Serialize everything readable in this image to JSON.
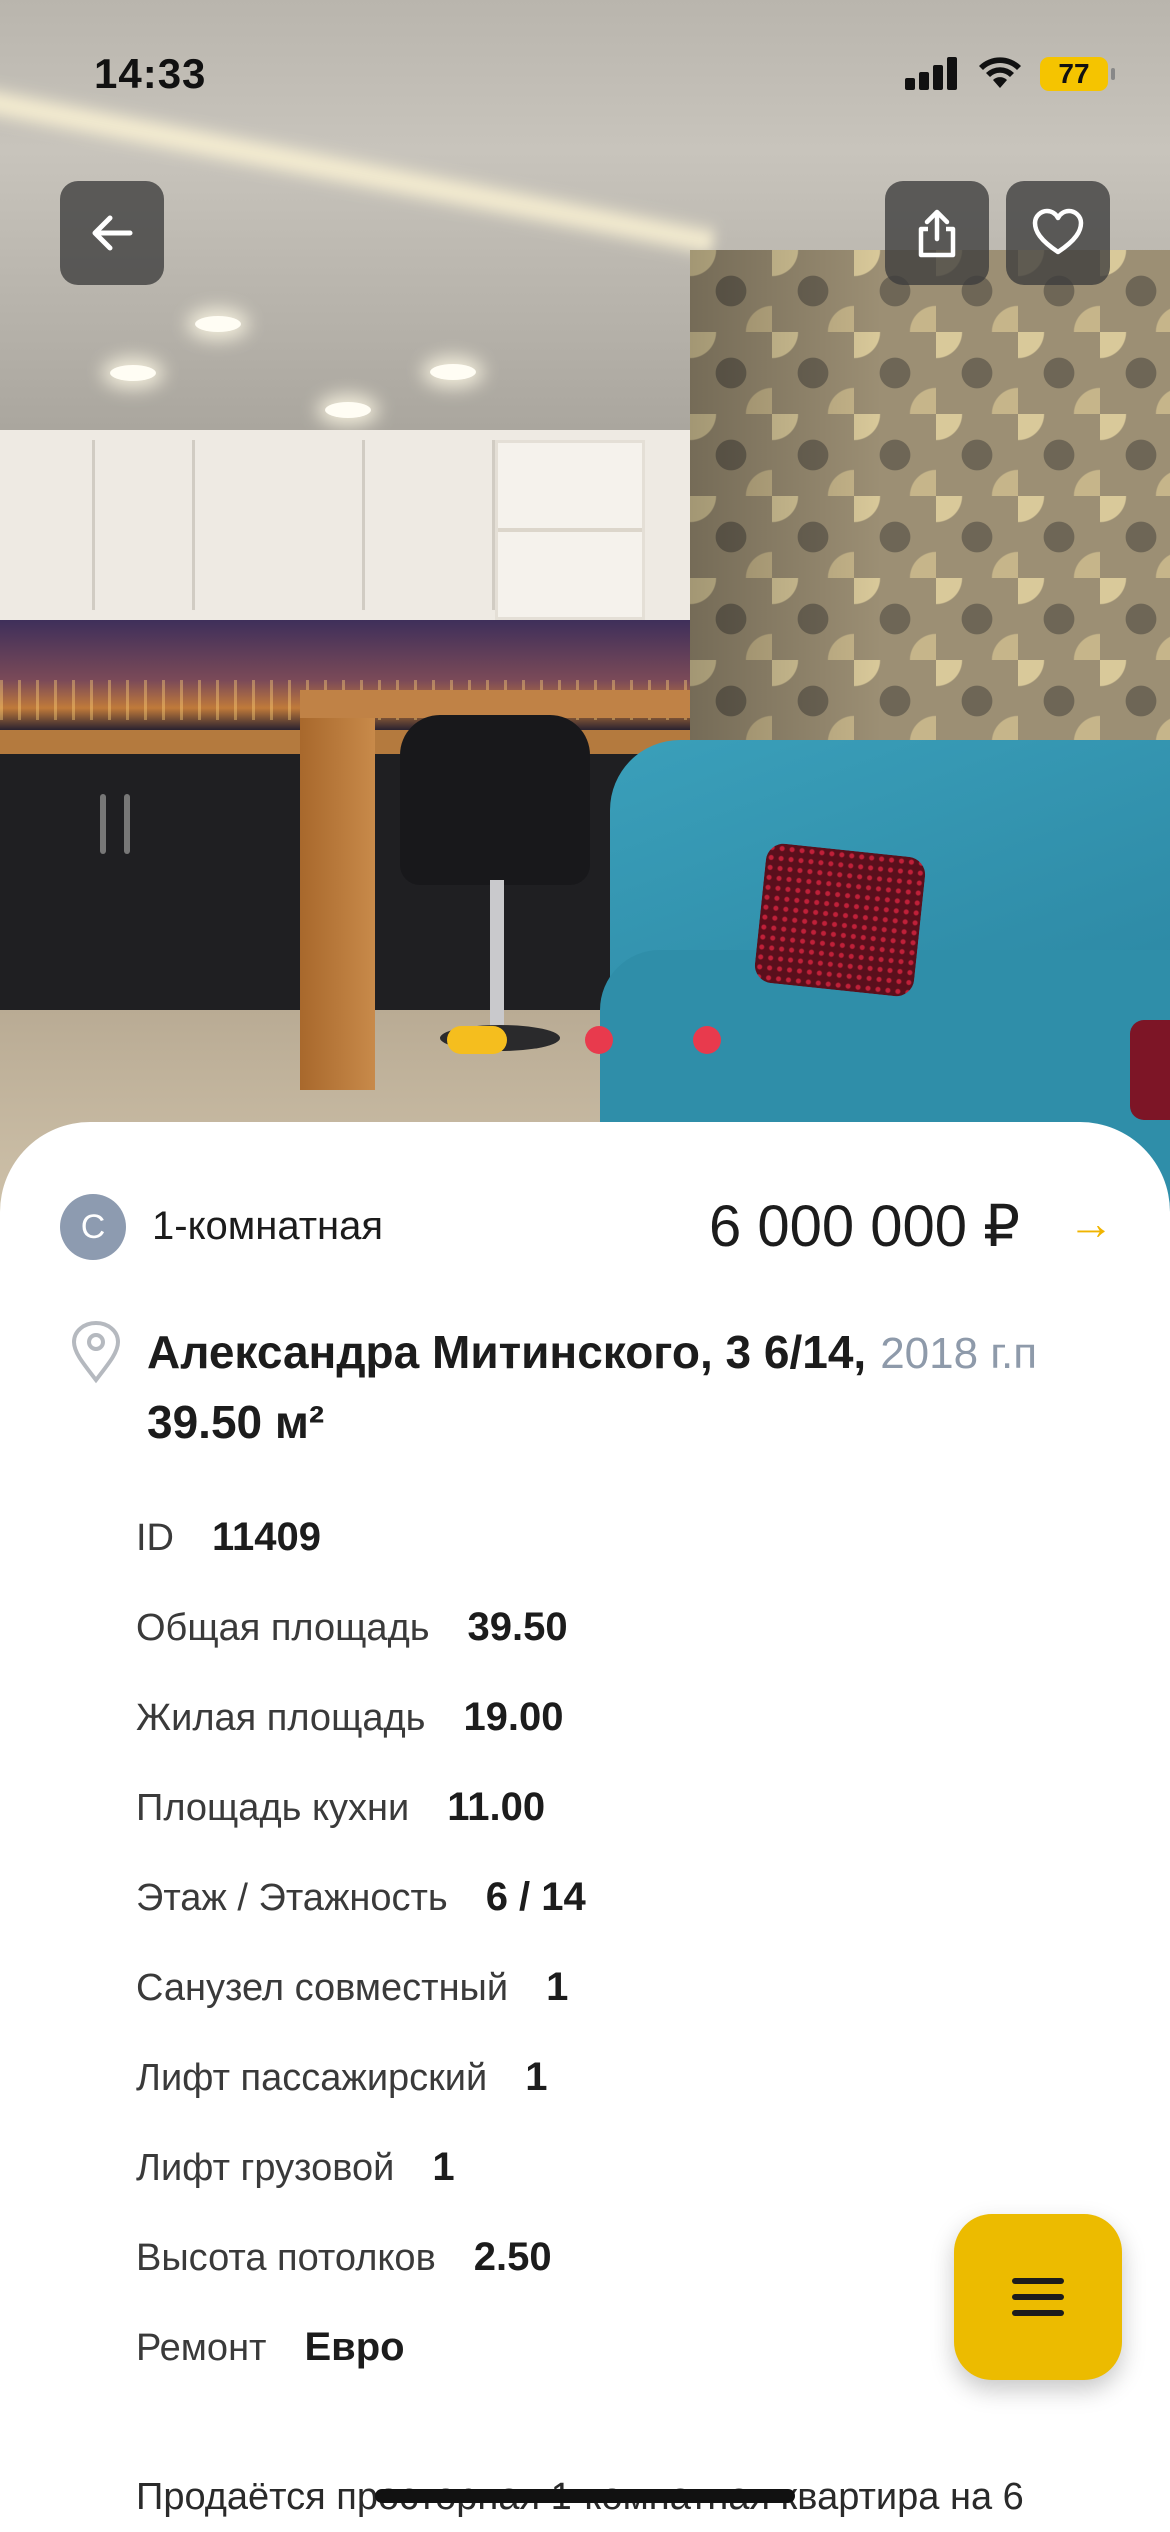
{
  "status_bar": {
    "time": "14:33",
    "battery": "77"
  },
  "photo": {
    "actions": {
      "back_icon": "arrow-left-icon",
      "share_icon": "share-icon",
      "favorite_icon": "heart-icon"
    },
    "carousel": {
      "count": 3,
      "active_index": 0,
      "colors": {
        "active": "#F5BE1E",
        "inactive": "#E83A4D"
      }
    }
  },
  "listing": {
    "type_badge": "С",
    "type": "1-комнатная",
    "price": "6 000 000 ₽",
    "price_arrow": "→",
    "address": "Александра Митинского, 3 6/14,",
    "year": "2018 г.п",
    "area": "39.50 м²",
    "properties": [
      {
        "key": "ID",
        "value": "11409"
      },
      {
        "key": "Общая площадь",
        "value": "39.50"
      },
      {
        "key": "Жилая площадь",
        "value": "19.00"
      },
      {
        "key": "Площадь кухни",
        "value": "11.00"
      },
      {
        "key": "Этаж / Этажность",
        "value": "6 / 14"
      },
      {
        "key": "Санузел совместный",
        "value": "1"
      },
      {
        "key": "Лифт пассажирский",
        "value": "1"
      },
      {
        "key": "Лифт грузовой",
        "value": "1"
      },
      {
        "key": "Высота потолков",
        "value": "2.50"
      },
      {
        "key": "Ремонт",
        "value": "Евро"
      }
    ],
    "description": "Продаётся просторная 1-комнатная квартира на 6"
  },
  "fab": {
    "icon": "menu-icon",
    "color": "#ECBB00"
  }
}
